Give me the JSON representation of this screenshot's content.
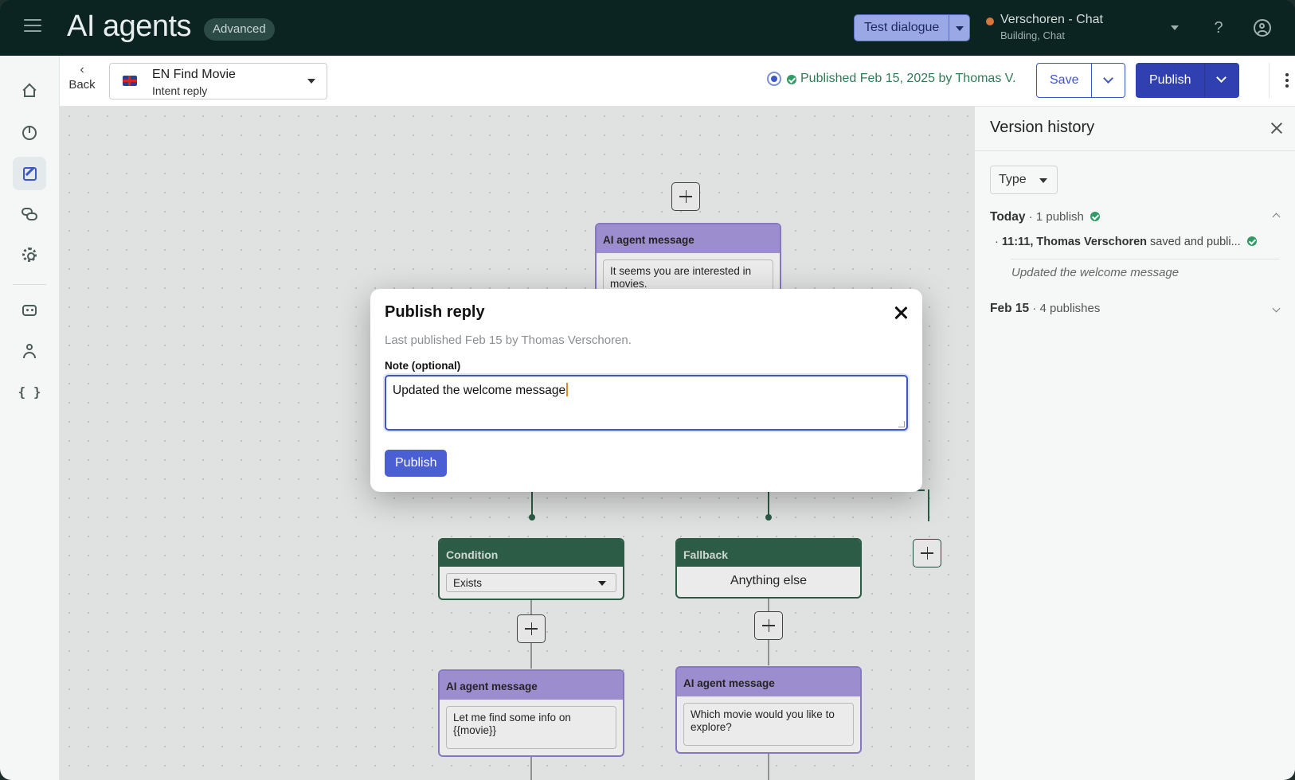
{
  "topbar": {
    "title": "AI agents",
    "badge": "Advanced",
    "test_dialogue": "Test dialogue",
    "environment": {
      "name": "Verschoren - Chat",
      "sub": "Building, Chat"
    },
    "help": "?"
  },
  "sidebar": {
    "items": [
      {
        "name": "home",
        "icon": "home-icon"
      },
      {
        "name": "analytics",
        "icon": "pie-chart-icon"
      },
      {
        "name": "build",
        "icon": "edit-icon",
        "active": true
      },
      {
        "name": "conversations",
        "icon": "chat-icon"
      },
      {
        "name": "settings",
        "icon": "gear-icon"
      },
      {
        "name": "agents",
        "icon": "bot-icon"
      },
      {
        "name": "users",
        "icon": "person-icon"
      },
      {
        "name": "code",
        "icon": "braces-icon",
        "glyph": "{ }"
      }
    ]
  },
  "subheader": {
    "back_label": "Back",
    "back_chevron": "‹",
    "intent_name": "EN Find Movie",
    "intent_type": "Intent reply",
    "status": "Published Feb 15, 2025 by Thomas V.",
    "save_label": "Save",
    "publish_label": "Publish"
  },
  "canvas": {
    "top_message": {
      "title": "AI agent message",
      "text": "It seems you are interested in movies."
    },
    "condition": {
      "title": "Condition",
      "select_value": "Exists"
    },
    "fallback": {
      "title": "Fallback",
      "value": "Anything else"
    },
    "left_message": {
      "title": "AI agent message",
      "text": "Let me find some info on {{movie}}"
    },
    "right_message": {
      "title": "AI agent message",
      "text": "Which movie would you like to explore?"
    }
  },
  "modal": {
    "title": "Publish reply",
    "subtitle": "Last published Feb 15 by Thomas Verschoren.",
    "note_label": "Note (optional)",
    "note_value": "Updated the welcome message",
    "publish_label": "Publish"
  },
  "version_history": {
    "title": "Version history",
    "type_filter": "Type",
    "groups": [
      {
        "day": "Today",
        "count": "1 publish",
        "expanded": true
      },
      {
        "day": "Feb 15",
        "count": "4 publishes",
        "expanded": false
      }
    ],
    "entry": {
      "time_user": "11:11, Thomas Verschoren",
      "action": "saved and publi...",
      "note": "Updated the welcome message"
    }
  },
  "colors": {
    "topbar_bg": "#0c2421",
    "primary": "#3f57c4",
    "publish_dark": "#3040b0",
    "published_green": "#2f9a62",
    "node_purple": "#a797e0",
    "node_green": "#2b5f48"
  }
}
